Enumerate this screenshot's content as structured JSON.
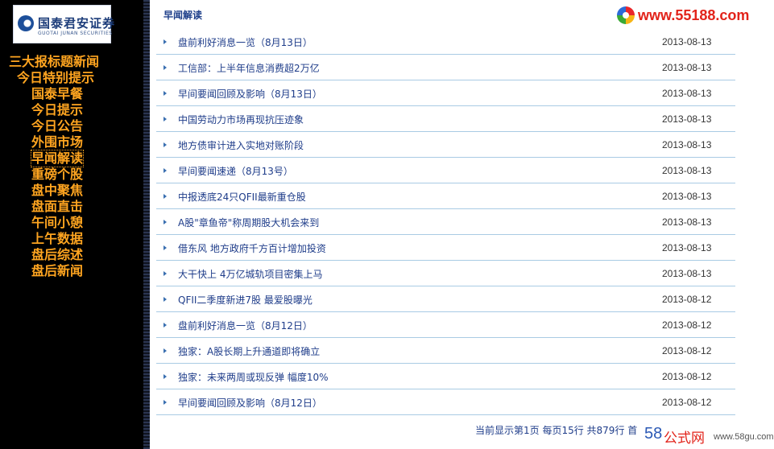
{
  "brand": {
    "logo_text": "国泰君安证券",
    "logo_sub": "GUOTAI JUNAN SECURITIES"
  },
  "nav": {
    "items": [
      {
        "label": "三大报标题新闻"
      },
      {
        "label": "今日特别提示"
      },
      {
        "label": "国泰早餐"
      },
      {
        "label": "今日提示"
      },
      {
        "label": "今日公告"
      },
      {
        "label": "外围市场"
      },
      {
        "label": "早闻解读"
      },
      {
        "label": "重磅个股"
      },
      {
        "label": "盘中聚焦"
      },
      {
        "label": "盘面直击"
      },
      {
        "label": "午间小憩"
      },
      {
        "label": "上午数据"
      },
      {
        "label": "盘后综述"
      },
      {
        "label": "盘后新闻"
      }
    ],
    "active_index": 6
  },
  "main": {
    "section_title": "早闻解读",
    "site_logo_text": "www.55188.com",
    "rows": [
      {
        "title": "盘前利好消息一览（8月13日）",
        "date": "2013-08-13"
      },
      {
        "title": "工信部：上半年信息消费超2万亿",
        "date": "2013-08-13"
      },
      {
        "title": "早间要闻回顾及影响（8月13日）",
        "date": "2013-08-13"
      },
      {
        "title": "中国劳动力市场再现抗压迹象",
        "date": "2013-08-13"
      },
      {
        "title": "地方债审计进入实地对账阶段",
        "date": "2013-08-13"
      },
      {
        "title": "早间要闻速递（8月13号）",
        "date": "2013-08-13"
      },
      {
        "title": "中报透底24只QFII最新重仓股",
        "date": "2013-08-13"
      },
      {
        "title": "A股\"章鱼帝\"称周期股大机会来到",
        "date": "2013-08-13"
      },
      {
        "title": "借东风 地方政府千方百计增加投资",
        "date": "2013-08-13"
      },
      {
        "title": "大干快上 4万亿城轨项目密集上马",
        "date": "2013-08-13"
      },
      {
        "title": "QFII二季度新进7股 最爱股曝光",
        "date": "2013-08-12"
      },
      {
        "title": "盘前利好消息一览（8月12日）",
        "date": "2013-08-12"
      },
      {
        "title": "独家：A股长期上升通道即将确立",
        "date": "2013-08-12"
      },
      {
        "title": "独家：未来两周或现反弹 幅度10%",
        "date": "2013-08-12"
      },
      {
        "title": "早间要闻回顾及影响（8月12日）",
        "date": "2013-08-12"
      }
    ],
    "pager_text": "当前显示第1页 每页15行 共879行  首"
  },
  "watermark": {
    "brand_num": "58",
    "brand_cn": "公式网",
    "url": "www.58gu.com"
  },
  "colors": {
    "nav_text": "#ffa520",
    "link": "#1f3d8a",
    "row_divider": "#a9cbe4"
  }
}
